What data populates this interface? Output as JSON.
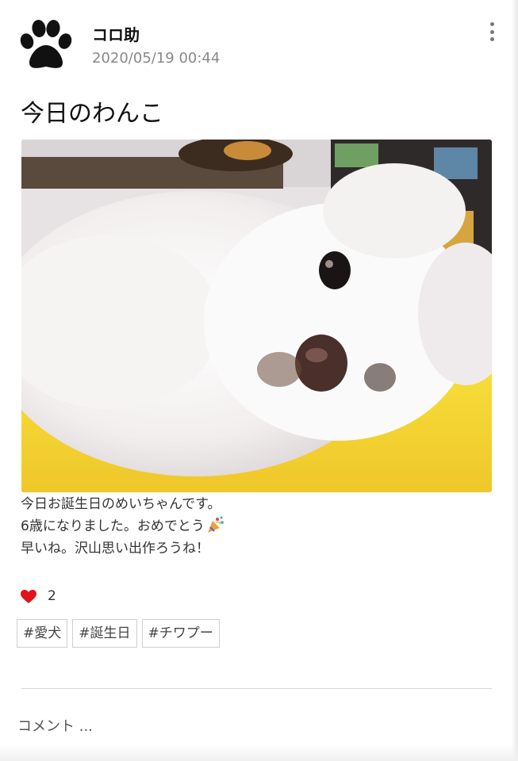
{
  "post": {
    "author": "コロ助",
    "timestamp": "2020/05/19 00:44",
    "title": "今日のわんこ",
    "body_lines": [
      "今日お誕生日のめいちゃんです。",
      "6歳になりました。おめでとう",
      "早いね。沢山思い出作ろうね！"
    ],
    "likes": "2",
    "tags": [
      "#愛犬",
      "#誕生日",
      "#チワプー"
    ]
  },
  "comment": {
    "placeholder": "コメント ..."
  },
  "icons": {
    "avatar": "paw-print-icon",
    "menu": "more-vertical-icon",
    "emoji": "party-popper-icon",
    "like": "heart-icon"
  },
  "colors": {
    "heart": "#e0151b",
    "paw": "#111111",
    "meta_text": "#888888"
  }
}
